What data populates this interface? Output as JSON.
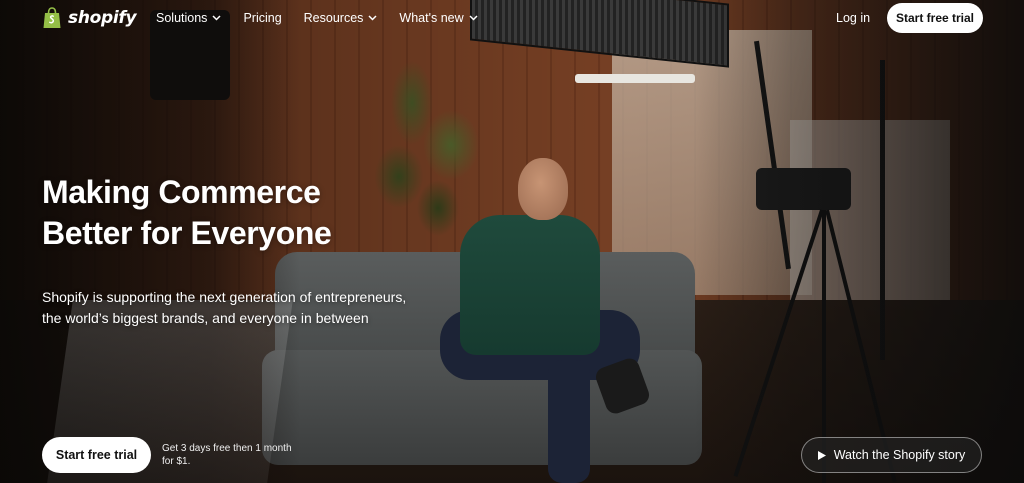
{
  "brand": {
    "logo_text": "shopify",
    "logo_color": "#95bf47"
  },
  "nav": {
    "items": [
      {
        "label": "Solutions",
        "has_dropdown": true
      },
      {
        "label": "Pricing",
        "has_dropdown": false
      },
      {
        "label": "Resources",
        "has_dropdown": true
      },
      {
        "label": "What's new",
        "has_dropdown": true
      }
    ],
    "login_label": "Log in",
    "cta_label": "Start free trial"
  },
  "hero": {
    "headline_line1": "Making Commerce",
    "headline_line2": "Better for Everyone",
    "subtext_line1": "Shopify is supporting the next generation of entrepreneurs,",
    "subtext_line2": "the world’s biggest brands, and everyone in between",
    "cta_label": "Start free trial",
    "offer_line1": "Get 3 days free then 1 month",
    "offer_line2": "for $1.",
    "story_label": "Watch the Shopify story"
  },
  "icons": {
    "logo": "shopping-bag-icon",
    "dropdown": "chevron-down-icon",
    "video": "play-icon"
  }
}
